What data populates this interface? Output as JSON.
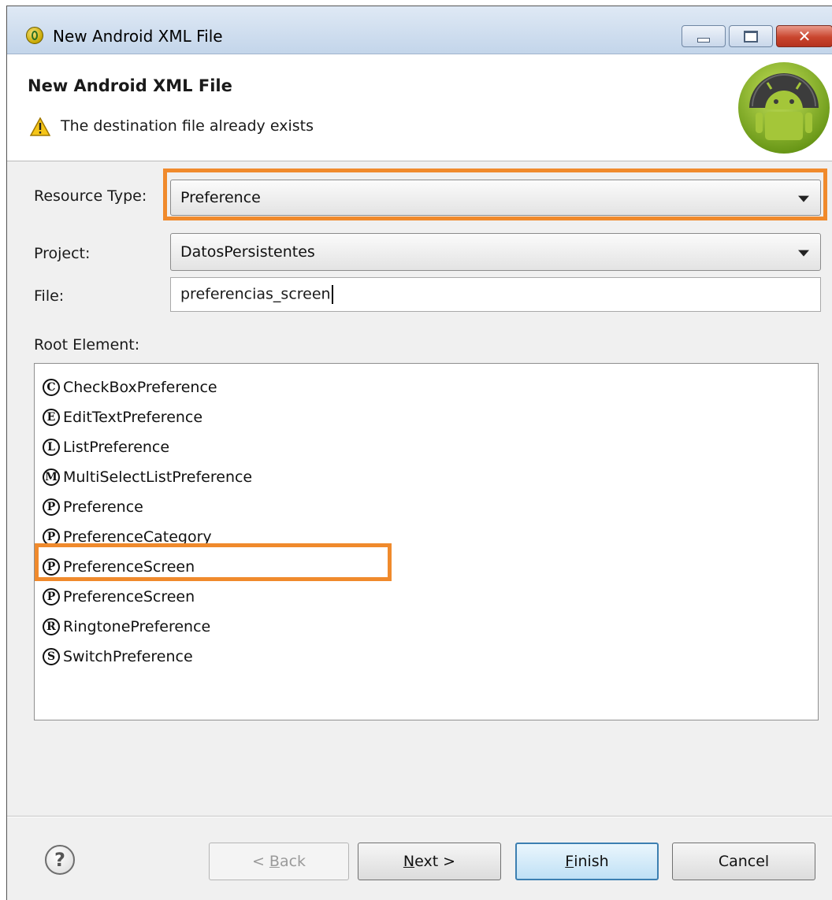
{
  "window": {
    "title": "New Android XML File",
    "controls": {
      "minimize": "–",
      "maximize": "□",
      "close": "✕"
    }
  },
  "banner": {
    "title": "New Android XML File",
    "message": "The destination file already exists",
    "warning_icon": "warning-triangle-icon",
    "logo": "android-logo"
  },
  "form": {
    "resource_type_label": "Resource Type:",
    "resource_type_value": "Preference",
    "project_label": "Project:",
    "project_value": "DatosPersistentes",
    "file_label": "File:",
    "file_value": "preferencias_screen",
    "root_element_label": "Root Element:"
  },
  "root_elements": [
    {
      "badge": "C",
      "label": "CheckBoxPreference"
    },
    {
      "badge": "E",
      "label": "EditTextPreference"
    },
    {
      "badge": "L",
      "label": "ListPreference"
    },
    {
      "badge": "M",
      "label": "MultiSelectListPreference"
    },
    {
      "badge": "P",
      "label": "Preference"
    },
    {
      "badge": "P",
      "label": "PreferenceCategory"
    },
    {
      "badge": "P",
      "label": "PreferenceScreen",
      "selected": true
    },
    {
      "badge": "P",
      "label": "PreferenceScreen"
    },
    {
      "badge": "R",
      "label": "RingtonePreference"
    },
    {
      "badge": "S",
      "label": "SwitchPreference"
    }
  ],
  "buttons": {
    "help": "?",
    "back_prefix": "< ",
    "back_key": "B",
    "back_rest": "ack",
    "next_key": "N",
    "next_rest": "ext >",
    "finish_key": "F",
    "finish_rest": "inish",
    "cancel": "Cancel"
  },
  "colors": {
    "highlight": "#f08a2c",
    "default_button_border": "#3c7fb1",
    "android_green": "#97c024"
  }
}
